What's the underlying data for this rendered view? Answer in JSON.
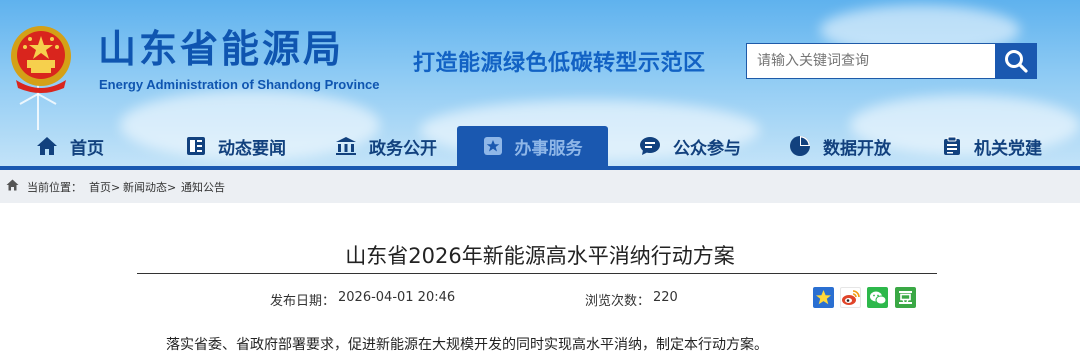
{
  "header": {
    "site_title": "山东省能源局",
    "site_subtitle": "Energy Administration of Shandong Province",
    "slogan": "打造能源绿色低碳转型示范区",
    "search": {
      "placeholder": "请输入关键词查询",
      "button_icon": "search-icon"
    }
  },
  "nav": {
    "items": [
      {
        "label": "首页",
        "icon": "home-icon"
      },
      {
        "label": "动态要闻",
        "icon": "news-icon"
      },
      {
        "label": "政务公开",
        "icon": "government-icon"
      },
      {
        "label": "办事服务",
        "icon": "service-icon",
        "active": true
      },
      {
        "label": "公众参与",
        "icon": "chat-icon"
      },
      {
        "label": "数据开放",
        "icon": "pie-chart-icon"
      },
      {
        "label": "机关党建",
        "icon": "party-building-icon"
      }
    ],
    "active_color": "#1a58b0"
  },
  "breadcrumb": {
    "prefix": "当前位置：",
    "items": [
      "首页>",
      "新闻动态>",
      "通知公告"
    ]
  },
  "article": {
    "title": "山东省2026年新能源高水平消纳行动方案",
    "publish_label": "发布日期：",
    "publish_date": "2026-04-01 20:46",
    "views_label": "浏览次数：",
    "views": "220",
    "share": [
      {
        "icon": "qzone-star-icon",
        "color": "#2a6fd1"
      },
      {
        "icon": "weibo-icon",
        "color": "#e0452a"
      },
      {
        "icon": "wechat-icon",
        "color": "#2db84b"
      },
      {
        "icon": "douban-icon",
        "color": "#3aa845"
      }
    ],
    "first_paragraph": "落实省委、省政府部署要求，促进新能源在大规模开发的同时实现高水平消纳，制定本行动方案。"
  }
}
